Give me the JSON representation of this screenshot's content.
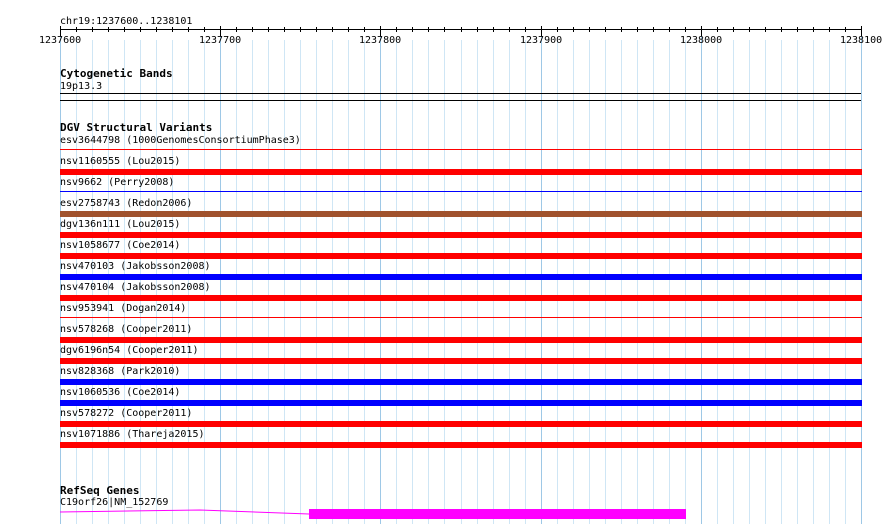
{
  "ruler": {
    "location": "chr19:1237600..1238101",
    "tick_labels": [
      "1237600",
      "1237700",
      "1237800",
      "1237900",
      "1238000",
      "1238100"
    ]
  },
  "tracks": {
    "cytoband": {
      "title": "Cytogenetic Bands",
      "band_label": "19p13.3"
    },
    "dgv": {
      "title": "DGV Structural Variants",
      "variants": [
        {
          "label": "esv3644798 (1000GenomesConsortiumPhase3)",
          "color": "#ff0000",
          "style": "thin"
        },
        {
          "label": "nsv1160555 (Lou2015)",
          "color": "#ff0000",
          "style": "thick"
        },
        {
          "label": "nsv9662 (Perry2008)",
          "color": "#0000ff",
          "style": "thin"
        },
        {
          "label": "esv2758743 (Redon2006)",
          "color": "#a0522d",
          "style": "thick"
        },
        {
          "label": "dgv136n111 (Lou2015)",
          "color": "#ff0000",
          "style": "thick"
        },
        {
          "label": "nsv1058677 (Coe2014)",
          "color": "#ff0000",
          "style": "thick"
        },
        {
          "label": "nsv470103 (Jakobsson2008)",
          "color": "#0000ff",
          "style": "thick"
        },
        {
          "label": "nsv470104 (Jakobsson2008)",
          "color": "#ff0000",
          "style": "thick"
        },
        {
          "label": "nsv953941 (Dogan2014)",
          "color": "#ff0000",
          "style": "thin"
        },
        {
          "label": "nsv578268 (Cooper2011)",
          "color": "#ff0000",
          "style": "thick"
        },
        {
          "label": "dgv6196n54 (Cooper2011)",
          "color": "#ff0000",
          "style": "thick"
        },
        {
          "label": "nsv828368 (Park2010)",
          "color": "#0000ff",
          "style": "thick"
        },
        {
          "label": "nsv1060536 (Coe2014)",
          "color": "#0000ff",
          "style": "thick"
        },
        {
          "label": "nsv578272 (Cooper2011)",
          "color": "#ff0000",
          "style": "thick"
        },
        {
          "label": "nsv1071886 (Thareja2015)",
          "color": "#ff0000",
          "style": "thick"
        }
      ]
    },
    "refseq": {
      "title": "RefSeq Genes",
      "gene_label": "C19orf26|NM_152769",
      "color": "#ff00ff"
    }
  }
}
